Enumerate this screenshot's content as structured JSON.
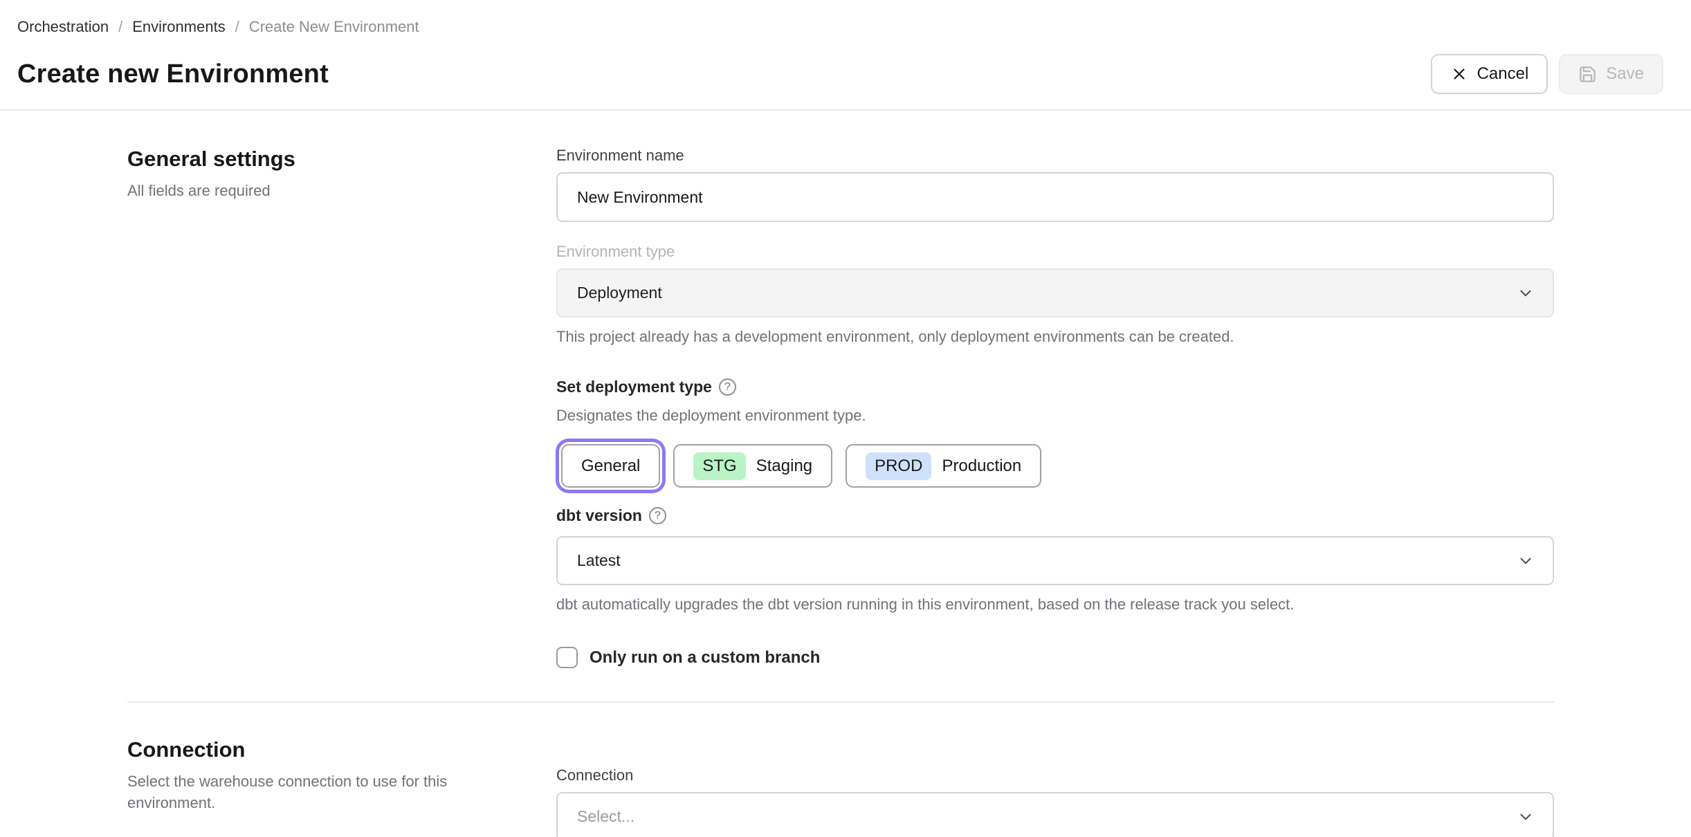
{
  "breadcrumb": {
    "separator": "/",
    "items": [
      {
        "label": "Orchestration"
      },
      {
        "label": "Environments"
      },
      {
        "label": "Create New Environment"
      }
    ]
  },
  "header": {
    "title": "Create new Environment",
    "cancel_label": "Cancel",
    "save_label": "Save"
  },
  "general": {
    "heading": "General settings",
    "subheading": "All fields are required",
    "environment_name": {
      "label": "Environment name",
      "value": "New Environment"
    },
    "environment_type": {
      "label": "Environment type",
      "value": "Deployment",
      "helper": "This project already has a development environment, only deployment environments can be created."
    },
    "deployment_type": {
      "label": "Set deployment type",
      "helper": "Designates the deployment environment type.",
      "options": [
        {
          "label": "General",
          "selected": true
        },
        {
          "badge": "STG",
          "label": "Staging",
          "selected": false
        },
        {
          "badge": "PROD",
          "label": "Production",
          "selected": false
        }
      ]
    },
    "dbt_version": {
      "label": "dbt version",
      "value": "Latest",
      "helper": "dbt automatically upgrades the dbt version running in this environment, based on the release track you select."
    },
    "custom_branch": {
      "label": "Only run on a custom branch",
      "checked": false
    }
  },
  "connection": {
    "heading": "Connection",
    "description": "Select the warehouse connection to use for this environment.",
    "field_label": "Connection",
    "placeholder": "Select..."
  },
  "colors": {
    "accent_purple": "#8c7af2",
    "staging_badge_bg": "#b9f4c6",
    "production_badge_bg": "#cfe0fb",
    "divider": "#e8e8ea"
  }
}
